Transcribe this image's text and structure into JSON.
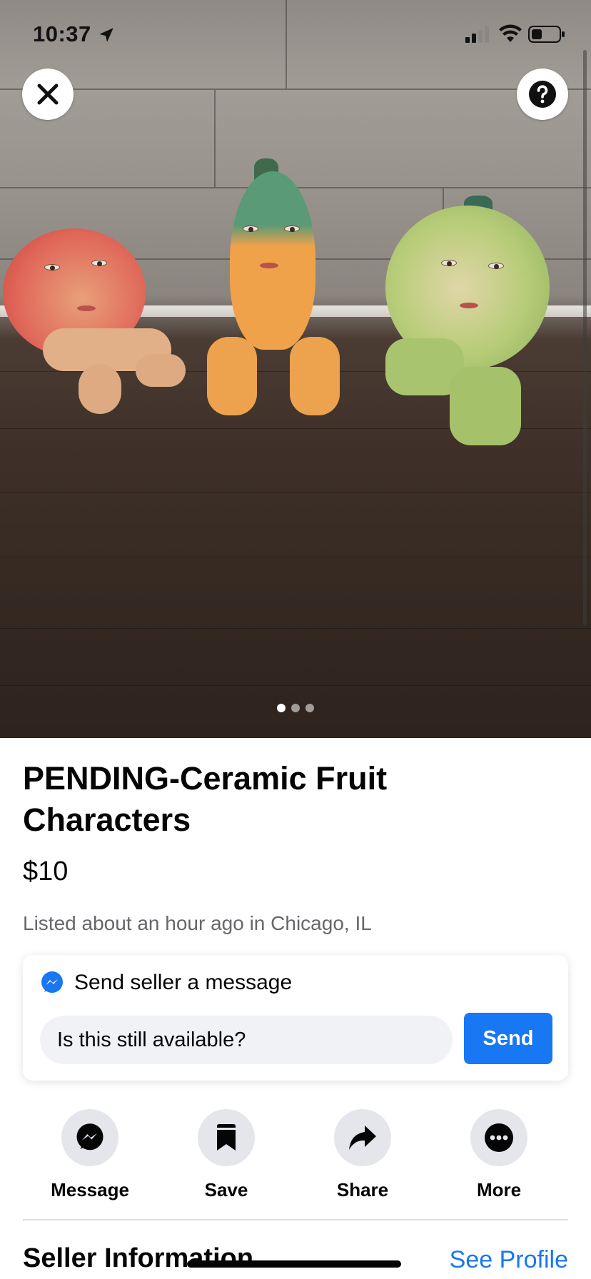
{
  "status_bar": {
    "time": "10:37"
  },
  "photo": {
    "carousel_total": 3,
    "carousel_active_index": 0,
    "close_icon": "close-icon",
    "help_icon": "help-icon"
  },
  "listing": {
    "title": "PENDING-Ceramic Fruit Characters",
    "price": "$10",
    "meta": "Listed about an hour ago in Chicago, IL"
  },
  "message_box": {
    "heading": "Send seller a message",
    "input_value": "Is this still available?",
    "send_label": "Send"
  },
  "actions": [
    {
      "label": "Message",
      "icon": "messenger-icon"
    },
    {
      "label": "Save",
      "icon": "bookmark-icon"
    },
    {
      "label": "Share",
      "icon": "share-arrow-icon"
    },
    {
      "label": "More",
      "icon": "more-dots-icon"
    }
  ],
  "seller": {
    "heading": "Seller Information",
    "see_profile_label": "See Profile"
  },
  "colors": {
    "accent": "#1877f2",
    "text_primary": "#050505",
    "text_secondary": "#65676b",
    "action_bg": "#e4e6eb",
    "input_bg": "#f0f2f5"
  }
}
